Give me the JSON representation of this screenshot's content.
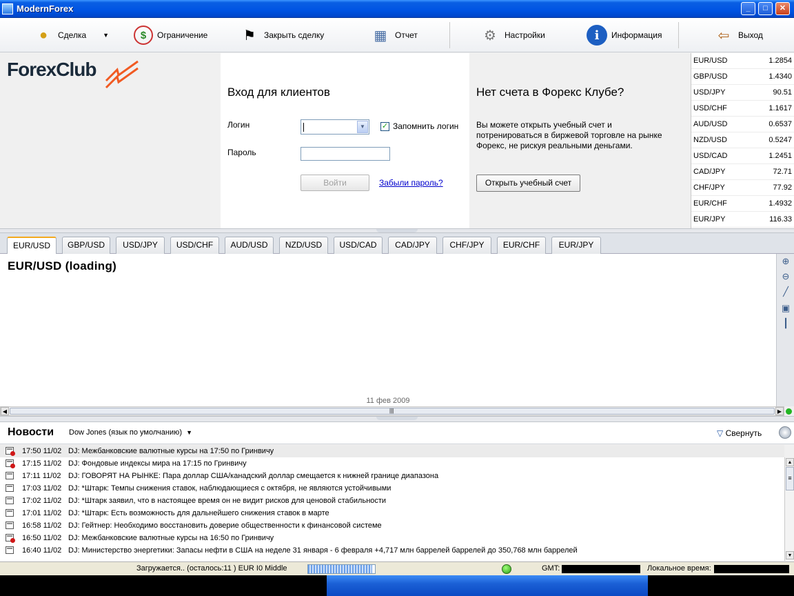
{
  "window": {
    "title": "ModernForex"
  },
  "toolbar": {
    "deal": "Сделка",
    "limit": "Ограничение",
    "close_deal": "Закрыть сделку",
    "report": "Отчет",
    "settings": "Настройки",
    "info": "Информация",
    "exit": "Выход"
  },
  "logo": {
    "text": "ForexClub"
  },
  "login": {
    "title": "Вход для клиентов",
    "login_label": "Логин",
    "remember_label": "Запомнить логин",
    "password_label": "Пароль",
    "submit": "Войти",
    "forgot": "Забыли пароль?"
  },
  "promo": {
    "title": "Нет счета в Форекс Клубе?",
    "text": "Вы можете открыть учебный счет и потренироваться в биржевой торговле на рынке Форекс, не рискуя реальными деньгами.",
    "button": "Открыть учебный счет"
  },
  "quotes": [
    {
      "pair": "EUR/USD",
      "rate": "1.2854"
    },
    {
      "pair": "GBP/USD",
      "rate": "1.4340"
    },
    {
      "pair": "USD/JPY",
      "rate": "90.51"
    },
    {
      "pair": "USD/CHF",
      "rate": "1.1617"
    },
    {
      "pair": "AUD/USD",
      "rate": "0.6537"
    },
    {
      "pair": "NZD/USD",
      "rate": "0.5247"
    },
    {
      "pair": "USD/CAD",
      "rate": "1.2451"
    },
    {
      "pair": "CAD/JPY",
      "rate": "72.71"
    },
    {
      "pair": "CHF/JPY",
      "rate": "77.92"
    },
    {
      "pair": "EUR/CHF",
      "rate": "1.4932"
    },
    {
      "pair": "EUR/JPY",
      "rate": "116.33"
    }
  ],
  "tabs": [
    "EUR/USD",
    "GBP/USD",
    "USD/JPY",
    "USD/CHF",
    "AUD/USD",
    "NZD/USD",
    "USD/CAD",
    "CAD/JPY",
    "CHF/JPY",
    "EUR/CHF",
    "EUR/JPY"
  ],
  "chart": {
    "title": "EUR/USD (loading)",
    "date": "11 фев 2009"
  },
  "news": {
    "title": "Новости",
    "source": "Dow Jones (язык по умолчанию)",
    "collapse": "Свернуть",
    "items": [
      {
        "time": "17:50 11/02",
        "text": "DJ: Межбанковские валютные курсы на 17:50 по Гринвичу",
        "alert": true
      },
      {
        "time": "17:15 11/02",
        "text": "DJ: Фондовые индексы мира на 17:15 по Гринвичу",
        "alert": true
      },
      {
        "time": "17:11 11/02",
        "text": "DJ: ГОВОРЯТ НА РЫНКЕ: Пара доллар США/канадский доллар смещается к нижней границе диапазона",
        "alert": false
      },
      {
        "time": "17:03 11/02",
        "text": "DJ: *Штарк: Темпы снижения ставок, наблюдающиеся с октября, не являются устойчивыми",
        "alert": false
      },
      {
        "time": "17:02 11/02",
        "text": "DJ: *Штарк заявил, что в настоящее время он не видит рисков для ценовой стабильности",
        "alert": false
      },
      {
        "time": "17:01 11/02",
        "text": "DJ: *Штарк: Есть возможность для дальнейшего снижения ставок в марте",
        "alert": false
      },
      {
        "time": "16:58 11/02",
        "text": "DJ: Гейтнер: Необходимо восстановить доверие общественности к финансовой системе",
        "alert": false
      },
      {
        "time": "16:50 11/02",
        "text": "DJ: Межбанковские валютные курсы на 16:50 по Гринвичу",
        "alert": true
      },
      {
        "time": "16:40 11/02",
        "text": "DJ: Министерство энергетики: Запасы нефти в США на неделе 31 января - 6 февраля +4,717 млн баррелей баррелей до 350,768 млн баррелей",
        "alert": false
      }
    ]
  },
  "status": {
    "loading": "Загружается.. (осталось:11 ) EUR I0  Middle",
    "gmt": "GMT:",
    "local": "Локальное время:"
  }
}
